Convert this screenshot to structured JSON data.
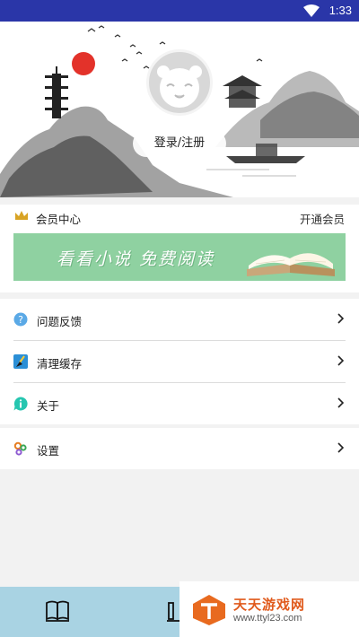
{
  "status_bar": {
    "time": "1:33",
    "icons": [
      "wifi-icon"
    ]
  },
  "profile": {
    "login_label": "登录/注册",
    "avatar_icon": "panda-avatar"
  },
  "member": {
    "label": "会员中心",
    "action": "开通会员",
    "icon": "crown-icon"
  },
  "promo": {
    "text": "看看小说 免费阅读",
    "icon": "open-book-image",
    "bg_color": "#8fd1a1"
  },
  "menu_group_1": [
    {
      "label": "问题反馈",
      "icon": "question-icon"
    },
    {
      "label": "清理缓存",
      "icon": "broom-icon"
    },
    {
      "label": "关于",
      "icon": "info-chat-icon"
    }
  ],
  "menu_group_2": [
    {
      "label": "设置",
      "icon": "gears-icon"
    }
  ],
  "bottom_nav": {
    "tabs": [
      "book-icon",
      "bookshelf-icon"
    ],
    "bg_color": "#a9d3e3"
  },
  "watermark": {
    "title": "天天游戏网",
    "url": "www.ttyl23.com"
  },
  "colors": {
    "status_bar": "#2a36a8",
    "page_bg": "#f2f2f2"
  }
}
